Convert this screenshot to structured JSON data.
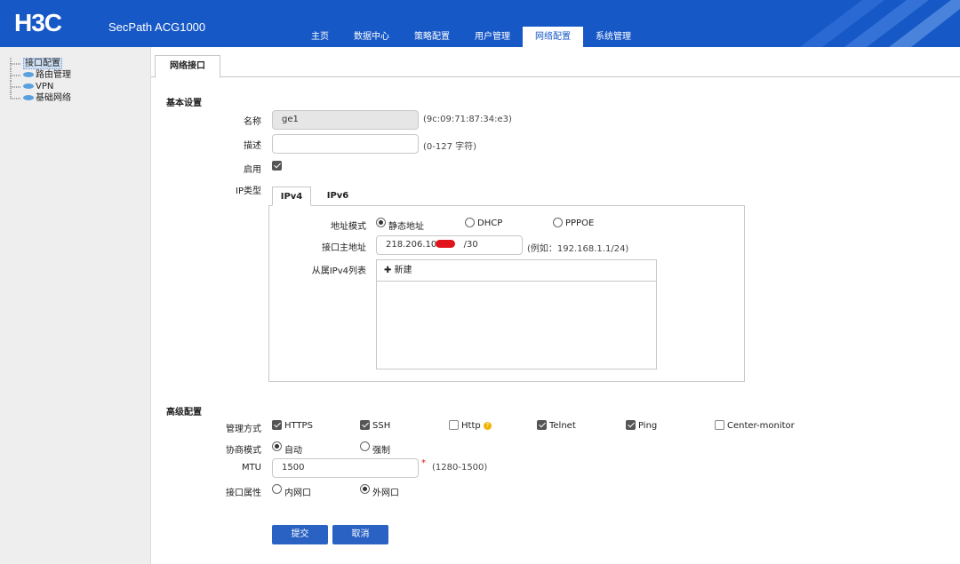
{
  "header": {
    "logo": "H3C",
    "product": "SecPath ACG1000",
    "nav": [
      "主页",
      "数据中心",
      "策略配置",
      "用户管理",
      "网络配置",
      "系统管理"
    ],
    "active_nav_index": 4,
    "colors": {
      "brand": "#1758c7"
    }
  },
  "sidebar": {
    "items": [
      {
        "label": "接口配置",
        "icon": "none",
        "selected": true
      },
      {
        "label": "路由管理",
        "icon": "leaf-icon"
      },
      {
        "label": "VPN",
        "icon": "leaf-icon"
      },
      {
        "label": "基础网络",
        "icon": "leaf-icon"
      }
    ]
  },
  "main": {
    "tab": "网络接口",
    "basic": {
      "title": "基本设置",
      "name_label": "名称",
      "name_value": "ge1",
      "mac": "(9c:09:71:87:34:e3)",
      "desc_label": "描述",
      "desc_value": "",
      "desc_hint": "(0-127 字符)",
      "enable_label": "启用",
      "enabled": true,
      "iptype_label": "IP类型",
      "ip_tabs": [
        "IPv4",
        "IPv6"
      ],
      "active_ip_tab": "IPv4",
      "addr_mode_label": "地址模式",
      "addr_modes": [
        "静态地址",
        "DHCP",
        "PPPOE"
      ],
      "addr_mode_selected": "静态地址",
      "primary_addr_label": "接口主地址",
      "primary_addr_value": "218.206.103",
      "primary_addr_suffix": "/30",
      "primary_addr_hint": "(例如：192.168.1.1/24)",
      "secondary_label": "从属IPv4列表",
      "new_label": "✚ 新建"
    },
    "advanced": {
      "title": "高级配置",
      "mgmt_label": "管理方式",
      "mgmt_options": [
        {
          "label": "HTTPS",
          "checked": true
        },
        {
          "label": "SSH",
          "checked": true
        },
        {
          "label": "Http",
          "checked": false
        },
        {
          "label": "Telnet",
          "checked": true
        },
        {
          "label": "Ping",
          "checked": true
        },
        {
          "label": "Center-monitor",
          "checked": false
        }
      ],
      "negotiation_label": "协商模式",
      "negotiation_options": [
        "自动",
        "强制"
      ],
      "negotiation_selected": "自动",
      "mtu_label": "MTU",
      "mtu_value": "1500",
      "mtu_required": "*",
      "mtu_hint": "(1280-1500)",
      "attr_label": "接口属性",
      "attr_options": [
        "内网口",
        "外网口"
      ],
      "attr_selected": "外网口"
    },
    "buttons": {
      "submit": "提交",
      "cancel": "取消"
    }
  }
}
